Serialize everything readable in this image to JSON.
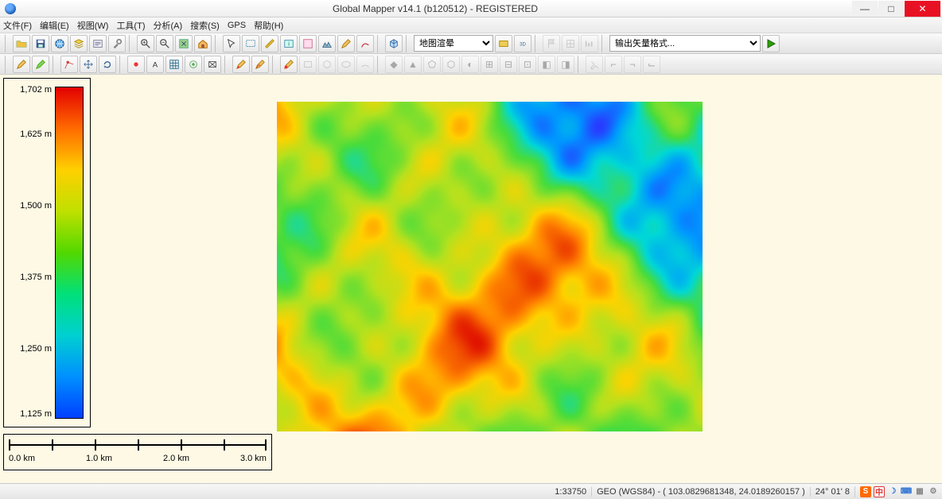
{
  "title": "Global Mapper v14.1 (b120512) - REGISTERED",
  "menu": [
    "文件(F)",
    "编辑(E)",
    "视图(W)",
    "工具(T)",
    "分析(A)",
    "搜索(S)",
    "GPS",
    "帮助(H)"
  ],
  "toolbar": {
    "render_select": "地图渲晕",
    "export_select": "输出矢量格式..."
  },
  "legend": {
    "ticks": [
      "1,702 m",
      "1,625 m",
      "1,500 m",
      "1,375 m",
      "1,250 m",
      "1,125 m"
    ]
  },
  "scale": {
    "labels": [
      "0.0 km",
      "1.0 km",
      "2.0 km",
      "3.0 km"
    ]
  },
  "status": {
    "scale_ratio": "1:33750",
    "proj": "GEO (WGS84) - ( 103.0829681348, 24.0189260157 )",
    "coord": "24° 01' 8",
    "ime": "中"
  }
}
